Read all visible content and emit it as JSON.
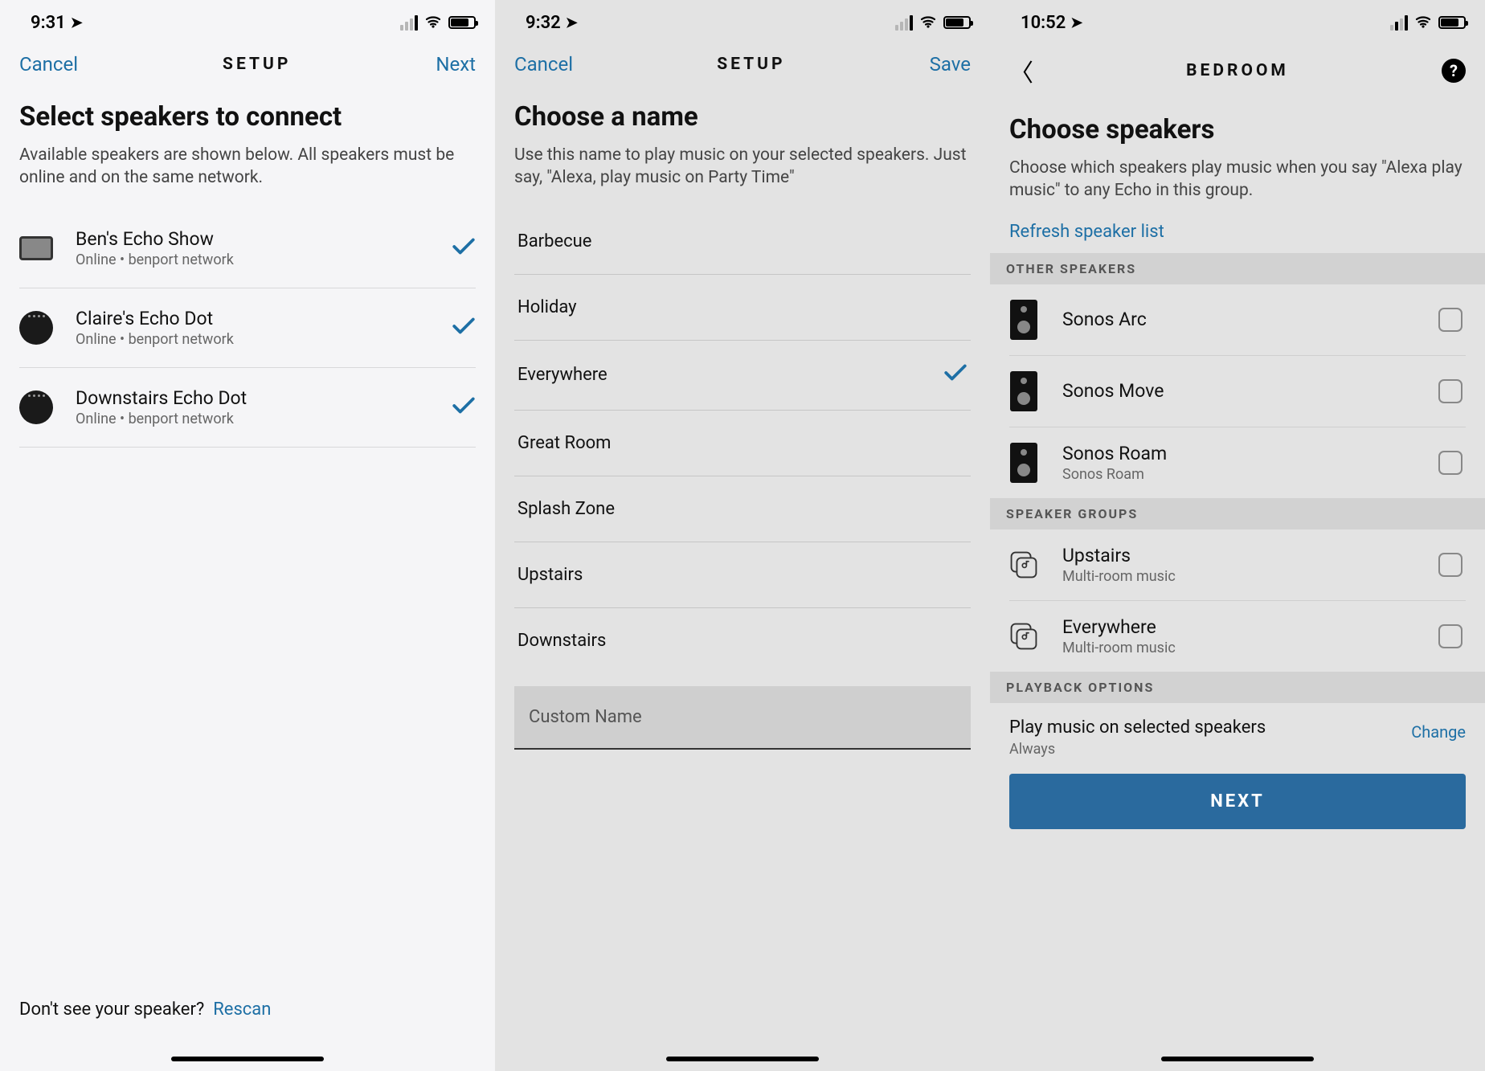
{
  "screen1": {
    "status": {
      "time": "9:31"
    },
    "nav": {
      "left": "Cancel",
      "title": "SETUP",
      "right": "Next"
    },
    "title": "Select speakers to connect",
    "subtitle": "Available speakers are shown below. All speakers must be online and on the same network.",
    "speakers": [
      {
        "name": "Ben's Echo Show",
        "meta": "Online • benport network",
        "icon": "echo-show"
      },
      {
        "name": "Claire's Echo Dot",
        "meta": "Online • benport network",
        "icon": "echo-dot"
      },
      {
        "name": "Downstairs Echo Dot",
        "meta": "Online • benport network",
        "icon": "echo-dot"
      }
    ],
    "footer": {
      "prompt": "Don't see your speaker?",
      "action": "Rescan"
    }
  },
  "screen2": {
    "status": {
      "time": "9:32"
    },
    "nav": {
      "left": "Cancel",
      "title": "SETUP",
      "right": "Save"
    },
    "title": "Choose a name",
    "subtitle": "Use this name to play music on your selected speakers. Just say, \"Alexa, play music on Party Time\"",
    "names": [
      {
        "label": "Barbecue",
        "selected": false
      },
      {
        "label": "Holiday",
        "selected": false
      },
      {
        "label": "Everywhere",
        "selected": true
      },
      {
        "label": "Great Room",
        "selected": false
      },
      {
        "label": "Splash Zone",
        "selected": false
      },
      {
        "label": "Upstairs",
        "selected": false
      },
      {
        "label": "Downstairs",
        "selected": false
      }
    ],
    "custom_placeholder": "Custom Name"
  },
  "screen3": {
    "status": {
      "time": "10:52"
    },
    "nav": {
      "title": "BEDROOM"
    },
    "title": "Choose speakers",
    "subtitle": "Choose which speakers play music when you say \"Alexa play music\" to any Echo in this group.",
    "refresh_link": "Refresh speaker list",
    "sections": {
      "other_speakers": {
        "header": "OTHER SPEAKERS",
        "items": [
          {
            "name": "Sonos Arc",
            "sub": ""
          },
          {
            "name": "Sonos Move",
            "sub": ""
          },
          {
            "name": "Sonos Roam",
            "sub": "Sonos Roam"
          }
        ]
      },
      "speaker_groups": {
        "header": "SPEAKER GROUPS",
        "items": [
          {
            "name": "Upstairs",
            "sub": "Multi-room music"
          },
          {
            "name": "Everywhere",
            "sub": "Multi-room music"
          }
        ]
      },
      "playback_options": {
        "header": "PLAYBACK OPTIONS",
        "title": "Play music on selected speakers",
        "sub": "Always",
        "change": "Change"
      }
    },
    "next_button": "NEXT"
  }
}
